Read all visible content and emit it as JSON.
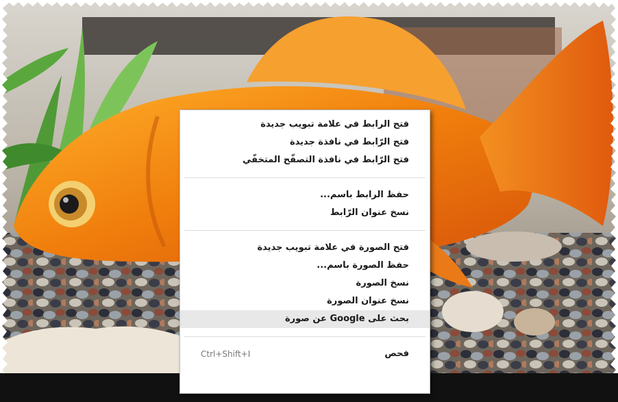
{
  "image": {
    "scene": "aquarium-goldfish-photo"
  },
  "context_menu": {
    "groups": [
      {
        "items": [
          {
            "label": "فتح الرابط في علامة تبويب جديدة"
          },
          {
            "label": "فتح الرّابط في نافذة جديدة"
          },
          {
            "label": "فتح الرّابط في نافذة التصفّح المتخفّي"
          }
        ]
      },
      {
        "items": [
          {
            "label": "حفظ الرابط باسم..."
          },
          {
            "label": "نسخ عنوان الرّابط"
          }
        ]
      },
      {
        "items": [
          {
            "label": "فتح الصورة في علامة تبويب جديدة"
          },
          {
            "label": "حفظ الصورة باسم..."
          },
          {
            "label": "نسخ الصورة"
          },
          {
            "label": "نسخ عنوان الصورة"
          },
          {
            "label": "بحث على Google عن صورة",
            "highlighted": true
          }
        ]
      },
      {
        "items": [
          {
            "label": "فحص",
            "shortcut": "Ctrl+Shift+I"
          }
        ]
      }
    ]
  },
  "colors": {
    "fish_orange": "#f08a10",
    "menu_bg": "#ffffff",
    "highlight": "#e8e8e8"
  }
}
